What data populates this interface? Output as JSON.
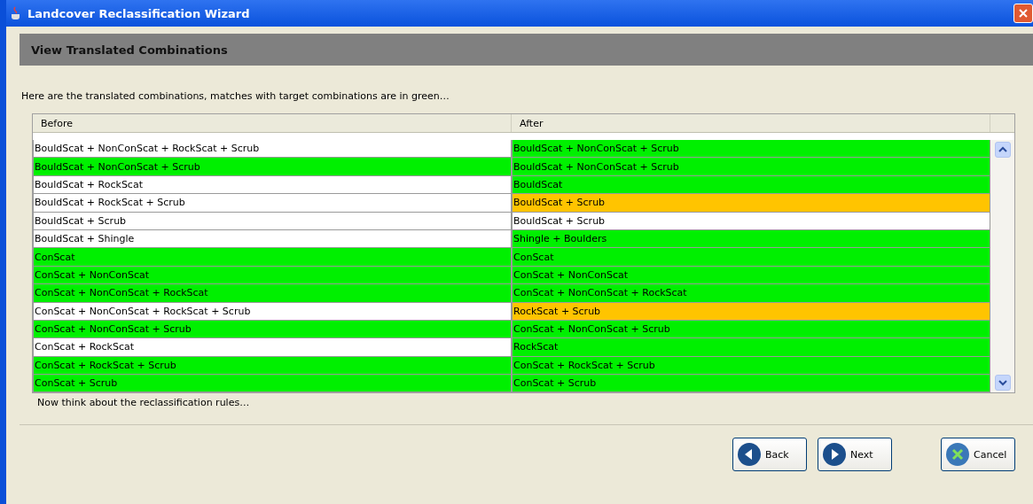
{
  "window": {
    "title": "Landcover Reclassification Wizard"
  },
  "header": {
    "title": "View Translated Combinations"
  },
  "intro": "Here are the translated combinations, matches with target combinations are in green…",
  "table": {
    "columns": [
      "Before",
      "After"
    ],
    "rows": [
      {
        "before": {
          "text": "BouldScat + NonConScat + RockScat + Scrub",
          "color": "#ffffff"
        },
        "after": {
          "text": "BouldScat + NonConScat + Scrub",
          "color": "#00f000"
        }
      },
      {
        "before": {
          "text": "BouldScat + NonConScat + Scrub",
          "color": "#00f000"
        },
        "after": {
          "text": "BouldScat + NonConScat + Scrub",
          "color": "#00f000"
        }
      },
      {
        "before": {
          "text": "BouldScat + RockScat",
          "color": "#ffffff"
        },
        "after": {
          "text": "BouldScat",
          "color": "#00f000"
        }
      },
      {
        "before": {
          "text": "BouldScat + RockScat + Scrub",
          "color": "#ffffff"
        },
        "after": {
          "text": "BouldScat + Scrub",
          "color": "#ffc400"
        }
      },
      {
        "before": {
          "text": "BouldScat + Scrub",
          "color": "#ffffff"
        },
        "after": {
          "text": "BouldScat + Scrub",
          "color": "#ffffff"
        }
      },
      {
        "before": {
          "text": "BouldScat + Shingle",
          "color": "#ffffff"
        },
        "after": {
          "text": "Shingle + Boulders",
          "color": "#00f000"
        }
      },
      {
        "before": {
          "text": "ConScat",
          "color": "#00f000"
        },
        "after": {
          "text": "ConScat",
          "color": "#00f000"
        }
      },
      {
        "before": {
          "text": "ConScat + NonConScat",
          "color": "#00f000"
        },
        "after": {
          "text": "ConScat + NonConScat",
          "color": "#00f000"
        }
      },
      {
        "before": {
          "text": "ConScat + NonConScat + RockScat",
          "color": "#00f000"
        },
        "after": {
          "text": "ConScat + NonConScat + RockScat",
          "color": "#00f000"
        }
      },
      {
        "before": {
          "text": "ConScat + NonConScat + RockScat + Scrub",
          "color": "#ffffff"
        },
        "after": {
          "text": "RockScat + Scrub",
          "color": "#ffc400"
        }
      },
      {
        "before": {
          "text": "ConScat + NonConScat + Scrub",
          "color": "#00f000"
        },
        "after": {
          "text": "ConScat + NonConScat + Scrub",
          "color": "#00f000"
        }
      },
      {
        "before": {
          "text": "ConScat + RockScat",
          "color": "#ffffff"
        },
        "after": {
          "text": "RockScat",
          "color": "#00f000"
        }
      },
      {
        "before": {
          "text": "ConScat + RockScat + Scrub",
          "color": "#00f000"
        },
        "after": {
          "text": "ConScat + RockScat + Scrub",
          "color": "#00f000"
        }
      },
      {
        "before": {
          "text": "ConScat + Scrub",
          "color": "#00f000"
        },
        "after": {
          "text": "ConScat + Scrub",
          "color": "#00f000"
        }
      }
    ]
  },
  "footer_note": "Now think about the reclassification rules…",
  "buttons": [
    {
      "kind": "back",
      "label": "Back"
    },
    {
      "kind": "next",
      "label": "Next"
    },
    {
      "kind": "cancel",
      "label": "Cancel"
    }
  ]
}
